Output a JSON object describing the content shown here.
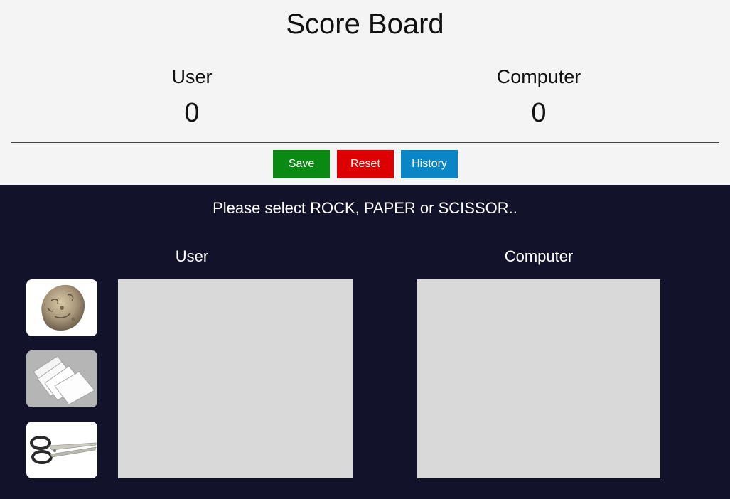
{
  "scoreboard": {
    "title": "Score Board",
    "user_label": "User",
    "user_score": "0",
    "computer_label": "Computer",
    "computer_score": "0"
  },
  "buttons": {
    "save": "Save",
    "reset": "Reset",
    "history": "History"
  },
  "colors": {
    "save": "#0a8a12",
    "reset": "#dd0000",
    "history": "#0a86c6",
    "background_dark": "#12132a"
  },
  "game": {
    "prompt": "Please select ROCK, PAPER or SCISSOR..",
    "user_title": "User",
    "computer_title": "Computer",
    "choices": [
      {
        "name": "rock",
        "icon": "rock-icon"
      },
      {
        "name": "paper",
        "icon": "paper-icon"
      },
      {
        "name": "scissor",
        "icon": "scissor-icon"
      }
    ]
  }
}
